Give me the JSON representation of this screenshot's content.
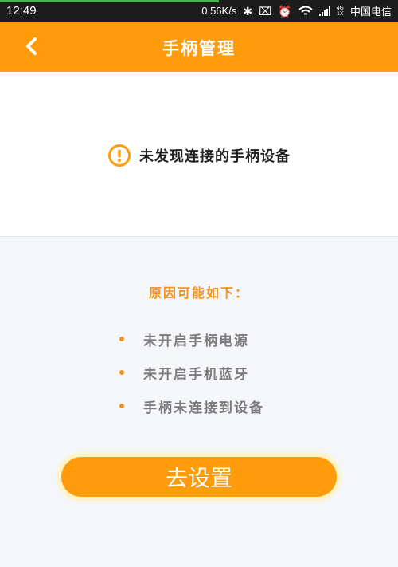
{
  "status_bar": {
    "time": "12:49",
    "speed": "0.56K/s",
    "network_top": "4G",
    "network_bottom": "1X",
    "carrier": "中国电信",
    "progress_fraction": 0.55
  },
  "app_bar": {
    "title": "手柄管理",
    "back_icon": "chevron-left-icon"
  },
  "notice": {
    "icon": "warning-circle-icon",
    "text": "未发现连接的手柄设备"
  },
  "reasons": {
    "title": "原因可能如下：",
    "items": [
      "未开启手柄电源",
      "未开启手机蓝牙",
      "手柄未连接到设备"
    ]
  },
  "action": {
    "setup_label": "去设置"
  },
  "colors": {
    "accent": "#ff9c0c",
    "bullet": "#f3931a",
    "background": "#f4f6f9"
  }
}
